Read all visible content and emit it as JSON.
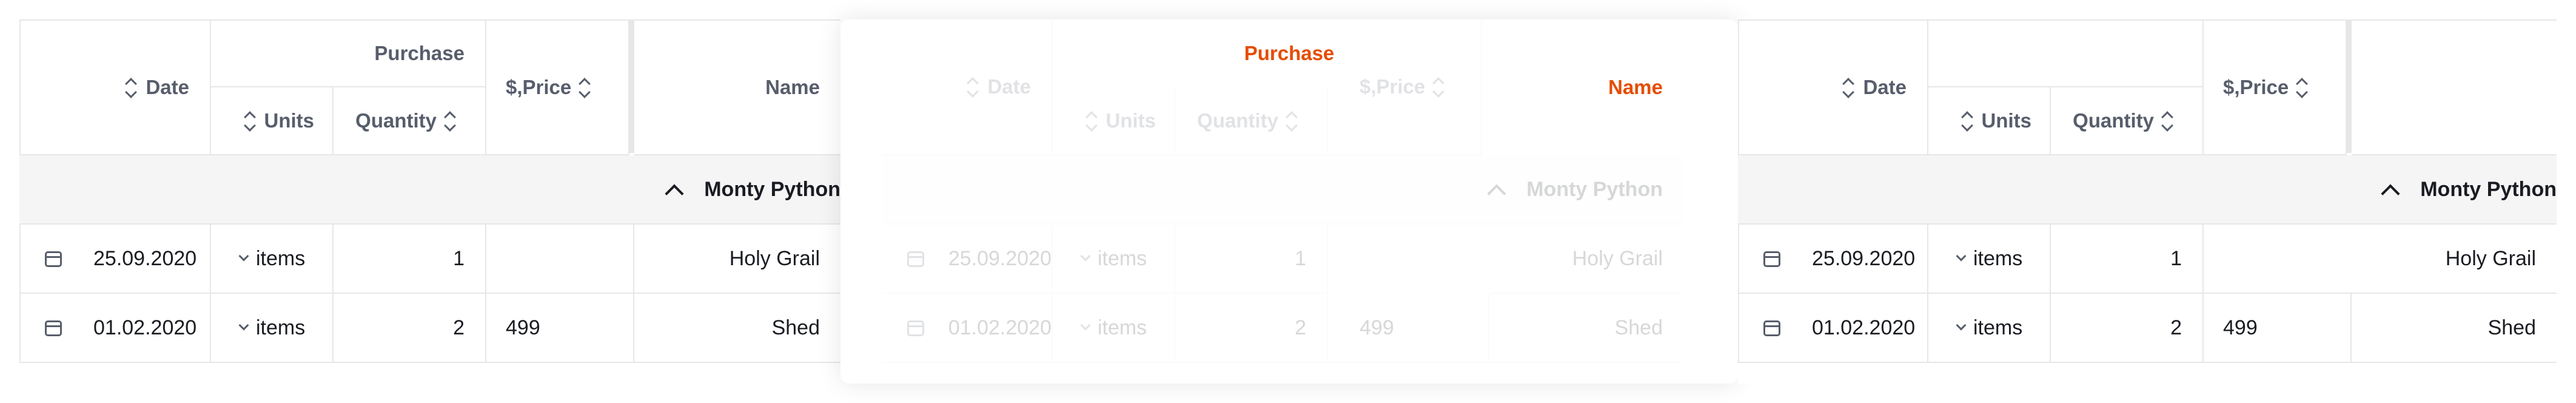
{
  "table": {
    "headers": {
      "date": "Date",
      "purchase": "Purchase",
      "units": "Units",
      "quantity": "Quantity",
      "price": "$,Price",
      "name": "Name"
    },
    "group": "Monty Python",
    "rows": [
      {
        "date": "25.09.2020",
        "units": "items",
        "quantity": "1",
        "price": "",
        "name": "Holy Grail"
      },
      {
        "date": "01.02.2020",
        "units": "items",
        "quantity": "2",
        "price": "499",
        "name": "Shed"
      }
    ]
  },
  "drag_preview": {
    "highlight_color": "#e44d00"
  }
}
